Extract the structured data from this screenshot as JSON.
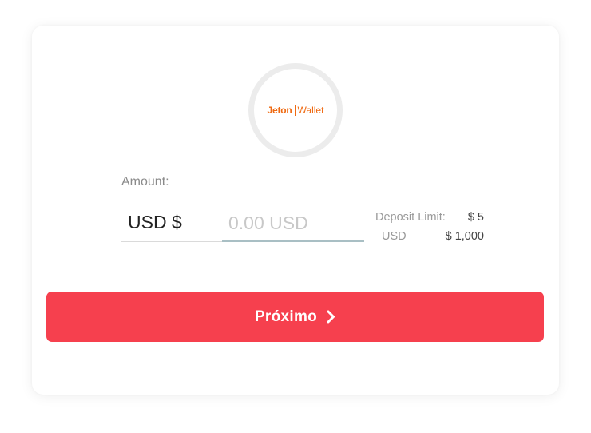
{
  "logo": {
    "brand": "Jeton",
    "sub": "Wallet",
    "color": "#ef6a12"
  },
  "form": {
    "amount_label": "Amount:",
    "currency": "USD $",
    "amount_value": "",
    "amount_placeholder": "0.00 USD"
  },
  "limits": {
    "deposit_limit_label": "Deposit Limit:",
    "deposit_limit_value": "$ 5",
    "currency_label": "USD",
    "max_value": "$ 1,000"
  },
  "button": {
    "label": "Próximo",
    "icon": "chevron-right-icon",
    "color": "#f6404e"
  }
}
